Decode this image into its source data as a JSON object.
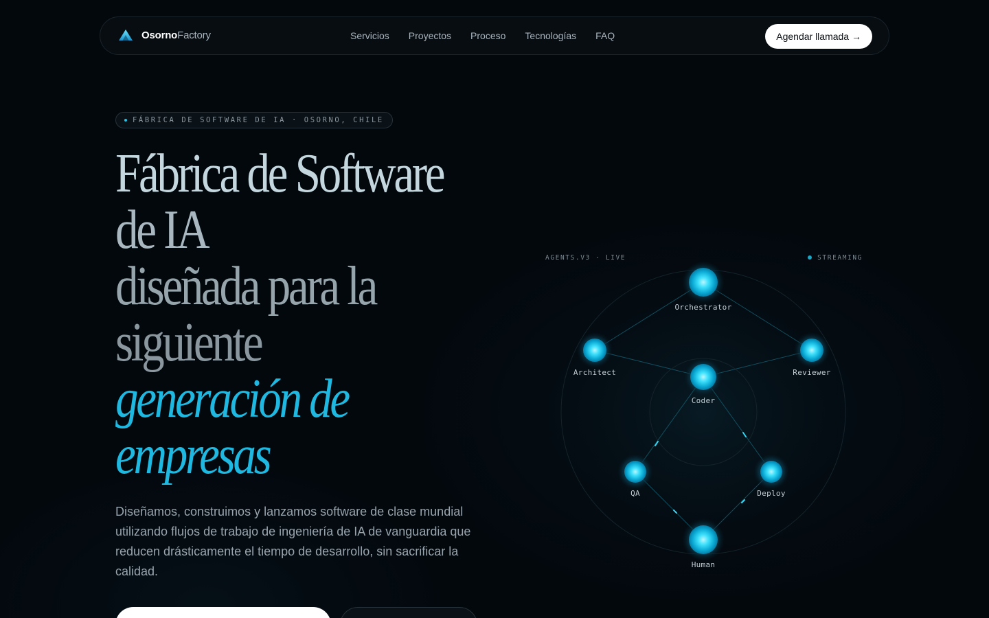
{
  "nav": {
    "brand_bold": "Osorno",
    "brand_light": "Factory",
    "links": [
      "Servicios",
      "Proyectos",
      "Proceso",
      "Tecnologías",
      "FAQ"
    ],
    "cta_label": "Agendar llamada →"
  },
  "hero": {
    "badge": "FÁBRICA DE SOFTWARE DE IA · OSORNO, CHILE",
    "headline_lines": [
      "Fábrica de Software",
      "de IA",
      "diseñada para la",
      "siguiente"
    ],
    "headline_accent": [
      "generación de",
      "empresas"
    ],
    "description": "Diseñamos, construimos y lanzamos software de clase mundial utilizando flujos de trabajo de ingeniería de IA de vanguardia que reducen drásticamente el tiempo de desarrollo, sin sacrificar la calidad."
  },
  "diagram": {
    "left_label": "AGENTS.V3 · LIVE",
    "right_label": "STREAMING",
    "nodes": [
      "Orchestrator",
      "Architect",
      "Reviewer",
      "Coder",
      "QA",
      "Deploy",
      "Human"
    ]
  },
  "colors": {
    "background": "#03080d",
    "accent": "#1fb8e0",
    "node_glow": "#19d4f0"
  }
}
